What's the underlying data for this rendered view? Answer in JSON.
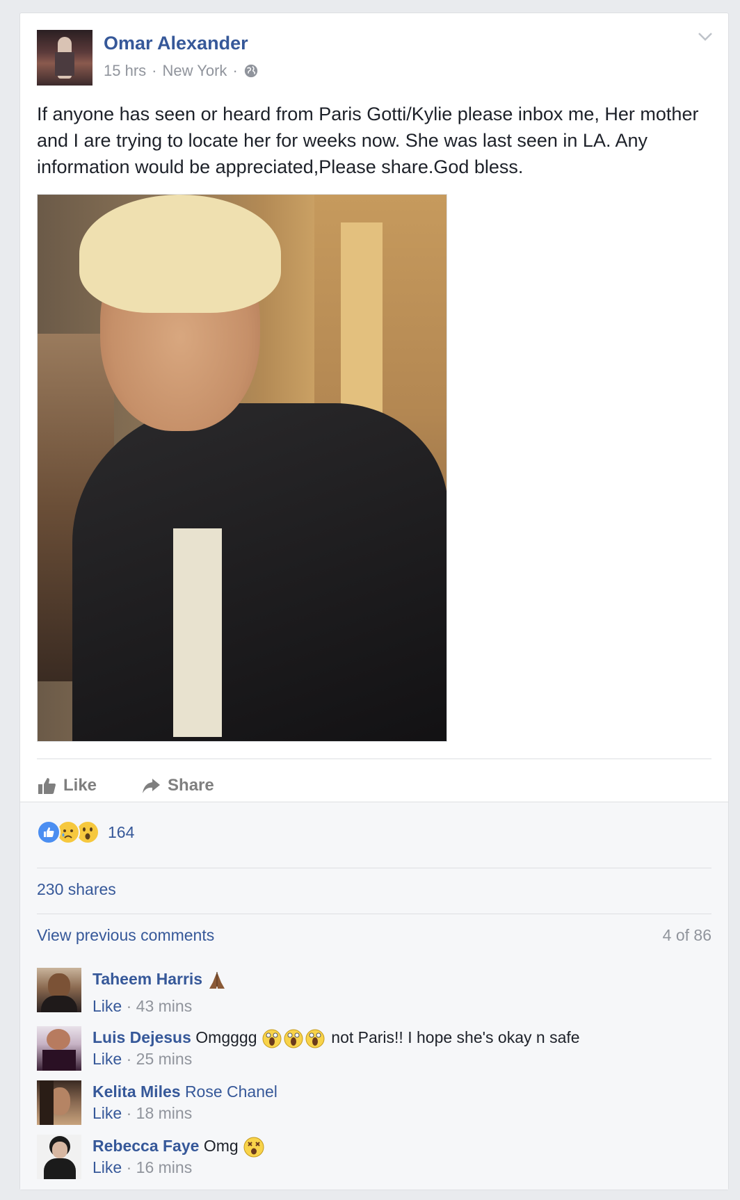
{
  "post": {
    "author": "Omar Alexander",
    "time": "15 hrs",
    "location": "New York",
    "separator": "·",
    "text": "If anyone has seen or heard from Paris Gotti/Kylie please inbox me, Her mother and I are trying to locate her for weeks now. She was last seen in LA. Any information would be appreciated,Please share.God bless."
  },
  "actions": {
    "like": "Like",
    "share": "Share"
  },
  "feedback": {
    "reaction_count": "164",
    "reaction_types": [
      "like",
      "sad",
      "wow"
    ],
    "shares": "230 shares",
    "view_previous": "View previous comments",
    "comment_count": "4 of 86"
  },
  "comments": [
    {
      "name": "Taheem Harris",
      "text": "",
      "emoji": "folded-hands",
      "like": "Like",
      "sep": "·",
      "time": "43 mins"
    },
    {
      "name": "Luis Dejesus",
      "text": "Omgggg",
      "text_after": "not Paris!! I hope she's okay n safe",
      "emoji": "scream x3",
      "like": "Like",
      "sep": "·",
      "time": "25 mins"
    },
    {
      "name": "Kelita Miles",
      "text": "Rose Chanel",
      "like": "Like",
      "sep": "·",
      "time": "18 mins"
    },
    {
      "name": "Rebecca Faye",
      "text": "Omg",
      "emoji": "dizzy-face",
      "like": "Like",
      "sep": "·",
      "time": "16 mins"
    }
  ],
  "colors": {
    "link": "#365899",
    "meta": "#90949c",
    "background": "#e9ebee",
    "feedback_bg": "#f6f7f9"
  }
}
